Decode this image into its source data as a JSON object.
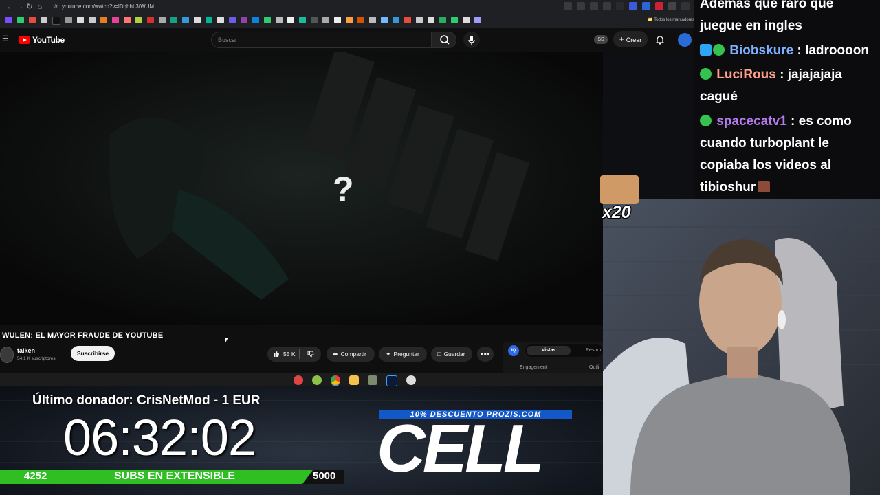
{
  "browser": {
    "url": "youtube.com/watch?v=lDqbhL3tWUM",
    "bookmarks_all": "Todos los marcadores"
  },
  "youtube": {
    "logo_text": "YouTube",
    "search_placeholder": "Buscar",
    "ss_badge": "SS",
    "create_label": "Crear"
  },
  "video": {
    "overlay_glyph": "?",
    "title": "WULEN: EL MAYOR FRAUDE DE YOUTUBE",
    "channel_name": "taiken",
    "channel_subs": "54,1 K suscriptores",
    "subscribe_label": "Suscribirse",
    "likes": "55 K",
    "share_label": "Compartir",
    "ask_label": "Preguntar",
    "save_label": "Guardar",
    "more_label": "•••"
  },
  "side_panel": {
    "icon_label": "IQ",
    "tab_active": "Vistas",
    "tab_other": "Resum",
    "label_engagement": "Engagement",
    "label_outlier": "Outli"
  },
  "overlay": {
    "last_donor": "Último donador: CrisNetMod - 1 EUR",
    "timer": "06:32:02",
    "subs_current": "4252",
    "subs_label": "SUBS EN EXTENSIBLE",
    "subs_goal": "5000",
    "promo": "10% DESCUENTO PROZIS.COM",
    "promo_code": "CELL"
  },
  "chat": {
    "messages": [
      {
        "user": "",
        "text": "Ademas que raro que"
      },
      {
        "user": "",
        "text": "juegue en ingles"
      },
      {
        "user": "Biobskure",
        "text": ": ladroooon"
      },
      {
        "user": "LuciRous",
        "text": ": jajajajaja"
      },
      {
        "user": "",
        "text": "cagué"
      },
      {
        "user": "spacecatv1",
        "text": ": es como"
      },
      {
        "user": "",
        "text": "cuando turboplant le"
      },
      {
        "user": "",
        "text": "copiaba los videos al"
      },
      {
        "user": "",
        "text": "tibioshur"
      }
    ],
    "user_colors": {
      "Biobskure": "#7db0ff",
      "LuciRous": "#ff9e8a",
      "spacecatv1": "#b57cf0"
    },
    "meme_count": "x20"
  },
  "colors": {
    "yt_red": "#ff0000",
    "subs_bar_green": "#2fbf23",
    "promo_blue": "#1358c9"
  }
}
